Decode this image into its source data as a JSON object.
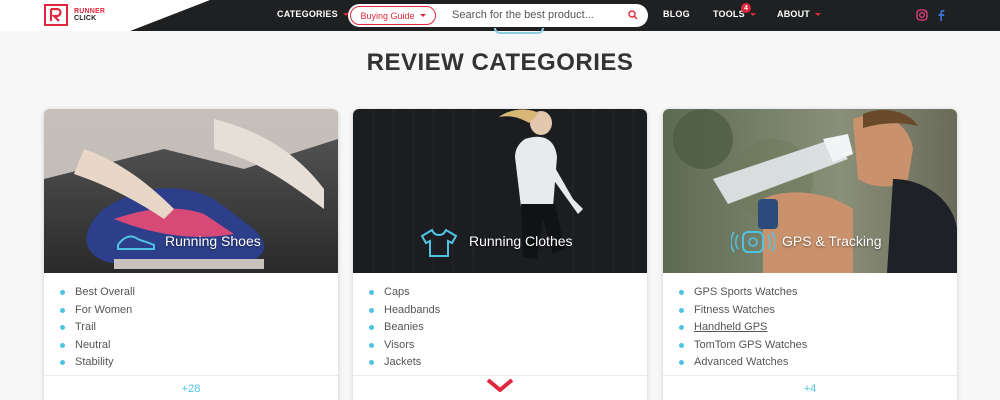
{
  "header": {
    "logo_line1": "RUNNER",
    "logo_line2": "CLICK",
    "nav": {
      "categories": "CATEGORIES",
      "buying_guide": "Buying Guide",
      "blog": "BLOG",
      "tools": "TOOLS",
      "tools_badge": "4",
      "about": "ABOUT"
    },
    "search": {
      "placeholder": "Search for the best product..."
    },
    "social": [
      "instagram-icon",
      "facebook-icon"
    ],
    "colors": {
      "bar": "#1f2022",
      "accent": "#e0283c",
      "bullet": "#4fc3e3"
    }
  },
  "main": {
    "heading": "REVIEW CATEGORIES",
    "cards": [
      {
        "title": "Running Shoes",
        "icon": "shoe-icon",
        "items": [
          "Best Overall",
          "For Women",
          "Trail",
          "Neutral",
          "Stability"
        ],
        "more": "+28"
      },
      {
        "title": "Running Clothes",
        "icon": "shirt-icon",
        "items": [
          "Caps",
          "Headbands",
          "Beanies",
          "Visors",
          "Jackets"
        ],
        "more_icon": "chevron-down-icon"
      },
      {
        "title": "GPS & Tracking",
        "icon": "gps-watch-icon",
        "items": [
          "GPS Sports Watches",
          "Fitness Watches",
          "Handheld GPS",
          "TomTom GPS Watches",
          "Advanced Watches"
        ],
        "more": "+4"
      }
    ]
  }
}
